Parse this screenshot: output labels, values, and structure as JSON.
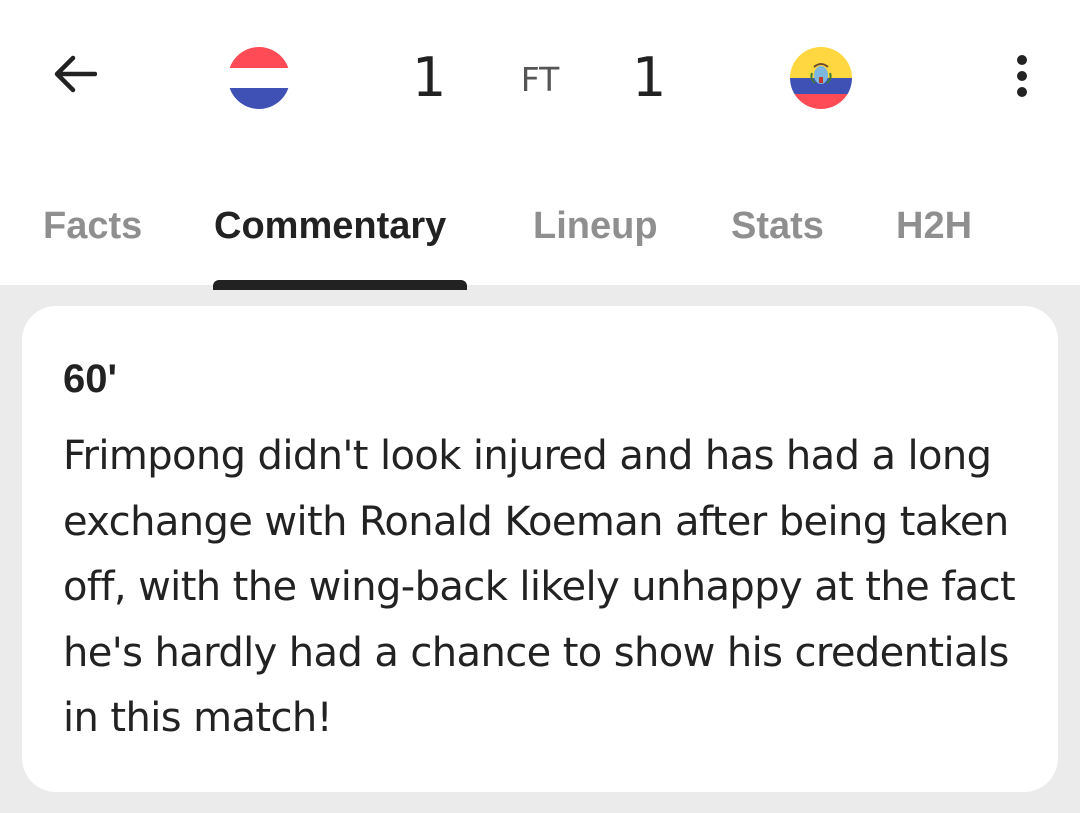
{
  "header": {
    "back_icon": "arrow-left-icon",
    "home_team": {
      "score": "1",
      "flag_icon": "netherlands-flag-icon",
      "flag_colors": [
        "#ff4b55",
        "#ffffff",
        "#3f51b5"
      ]
    },
    "status": "FT",
    "away_team": {
      "score": "1",
      "flag_icon": "ecuador-flag-icon",
      "flag_colors": [
        "#ffd740",
        "#3f51b5",
        "#ff4b55"
      ]
    },
    "more_icon": "more-vertical-icon"
  },
  "tabs": [
    {
      "label": "Facts",
      "active": false
    },
    {
      "label": "Commentary",
      "active": true
    },
    {
      "label": "Lineup",
      "active": false
    },
    {
      "label": "Stats",
      "active": false
    },
    {
      "label": "H2H",
      "active": false
    }
  ],
  "commentary": {
    "minute": "60'",
    "text": "Frimpong didn't look injured and has had a long exchange with Ronald Koeman after being taken off, with the wing-back likely unhappy at the fact he's hardly had a chance to show his credentials in this match!"
  },
  "colors": {
    "background": "#ebebeb",
    "surface": "#ffffff",
    "text_primary": "#222222",
    "text_inactive": "#8f8f8f"
  }
}
